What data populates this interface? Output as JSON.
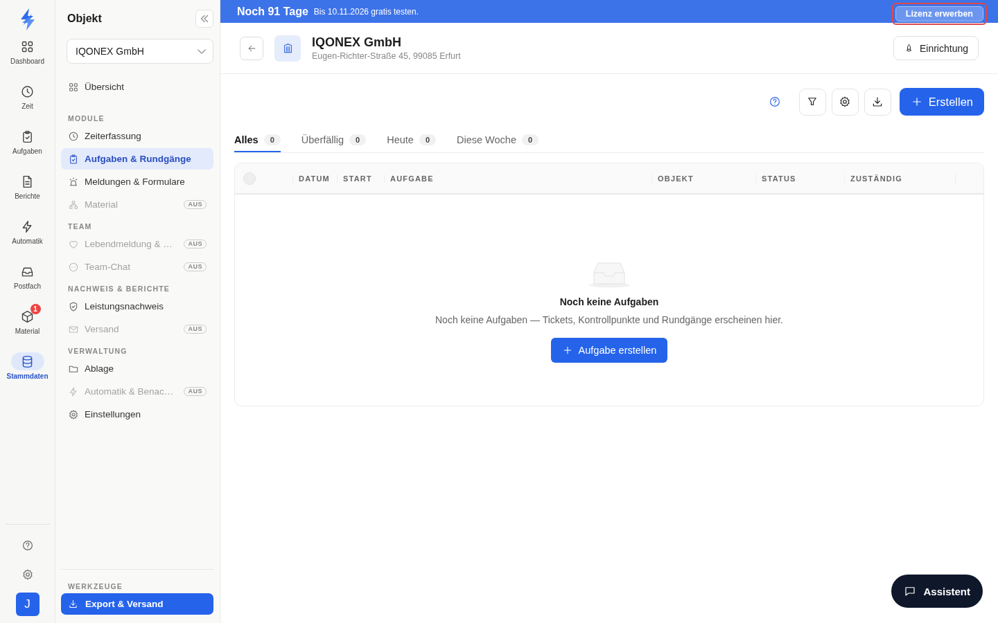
{
  "rail": {
    "items": [
      {
        "label": "Dashboard",
        "selected": false
      },
      {
        "label": "Zeit",
        "selected": false
      },
      {
        "label": "Aufgaben",
        "selected": false
      },
      {
        "label": "Berichte",
        "selected": false
      },
      {
        "label": "Automatik",
        "selected": false
      },
      {
        "label": "Postfach",
        "selected": false
      },
      {
        "label": "Material",
        "selected": false,
        "badge": "1"
      },
      {
        "label": "Stammdaten",
        "selected": true
      }
    ],
    "avatar": "J"
  },
  "sidebar": {
    "title": "Objekt",
    "select_value": "IQONEX GmbH",
    "overview": {
      "label": "Übersicht",
      "selected": false,
      "off": false
    },
    "sections": [
      {
        "heading": "MODULE",
        "items": [
          {
            "label": "Zeiterfassung",
            "selected": false,
            "off": false
          },
          {
            "label": "Aufgaben & Rundgänge",
            "selected": true,
            "off": false
          },
          {
            "label": "Meldungen & Formulare",
            "selected": false,
            "off": false
          },
          {
            "label": "Material",
            "selected": false,
            "off": true,
            "badge": "AUS"
          }
        ]
      },
      {
        "heading": "TEAM",
        "items": [
          {
            "label": "Lebendmeldung & …",
            "selected": false,
            "off": true,
            "badge": "AUS"
          },
          {
            "label": "Team-Chat",
            "selected": false,
            "off": true,
            "badge": "AUS"
          }
        ]
      },
      {
        "heading": "NACHWEIS & BERICHTE",
        "items": [
          {
            "label": "Leistungsnachweis",
            "selected": false,
            "off": false
          },
          {
            "label": "Versand",
            "selected": false,
            "off": true,
            "badge": "AUS"
          }
        ]
      },
      {
        "heading": "VERWALTUNG",
        "items": [
          {
            "label": "Ablage",
            "selected": false,
            "off": false
          },
          {
            "label": "Automatik & Benac…",
            "selected": false,
            "off": true,
            "badge": "AUS"
          },
          {
            "label": "Einstellungen",
            "selected": false,
            "off": false
          }
        ]
      }
    ],
    "tools": {
      "heading": "WERKZEUGE",
      "button": "Export & Versand"
    }
  },
  "banner": {
    "title": "Noch 91 Tage",
    "text": "Bis 10.11.2026 gratis testen.",
    "button": "Lizenz erwerben"
  },
  "header": {
    "title": "IQONEX GmbH",
    "address": "Eugen-Richter-Straße 45, 99085 Erfurt",
    "button": "Einrichtung"
  },
  "toolbar": {
    "create": "Erstellen"
  },
  "tabs": [
    {
      "label": "Alles",
      "count": "0",
      "selected": true
    },
    {
      "label": "Überfällig",
      "count": "0",
      "selected": false
    },
    {
      "label": "Heute",
      "count": "0",
      "selected": false
    },
    {
      "label": "Diese Woche",
      "count": "0",
      "selected": false
    }
  ],
  "table": {
    "select_all": {
      "checked": false
    },
    "columns": [
      "DATUM",
      "START",
      "AUFGABE",
      "OBJEKT",
      "STATUS",
      "ZUSTÄNDIG"
    ]
  },
  "empty": {
    "title": "Noch keine Aufgaben",
    "text": "Noch keine Aufgaben — Tickets, Kontrollpunkte und Rundgänge erscheinen hier.",
    "button": "Aufgabe erstellen"
  },
  "assistant": "Assistent"
}
